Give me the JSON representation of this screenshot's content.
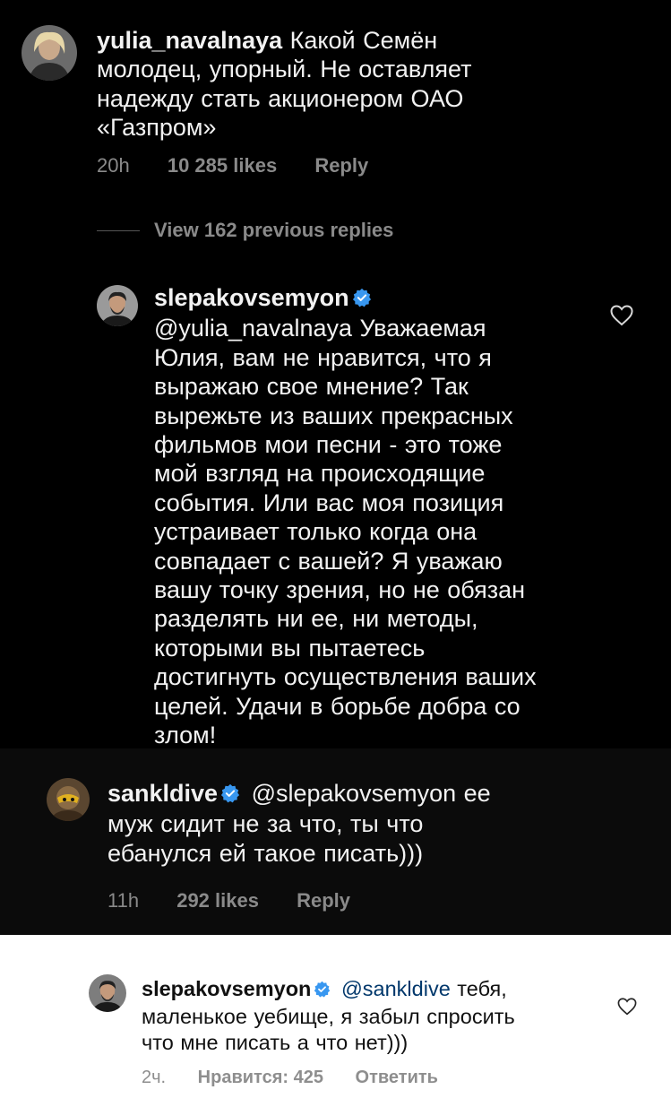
{
  "comment1": {
    "username": "yulia_navalnaya",
    "text_lines": [
      "Какой Семён",
      "молодец, упорный. Не оставляет",
      "надежду стать  акционером  ОАО",
      "«Газпром»"
    ],
    "time": "20h",
    "likes": "10 285 likes",
    "reply": "Reply"
  },
  "view_replies": "View 162 previous replies",
  "reply1": {
    "username": "slepakovsemyon",
    "verified": true,
    "text_lines": [
      "@yulia_navalnaya Уважаемая",
      "Юлия, вам не нравится, что я",
      "выражаю свое мнение? Так",
      "вырежьте из ваших прекрасных",
      "фильмов мои песни - это тоже",
      "мой взгляд на происходящие",
      "события. Или вас моя позиция",
      "устраивает только когда она",
      "совпадает с вашей? Я уважаю",
      "вашу точку зрения, но не обязан",
      "разделять ни ее, ни методы,",
      "которыми вы пытаетесь",
      "достигнуть осуществления ваших",
      "целей. Удачи в борьбе добра со",
      "злом!"
    ]
  },
  "comment2": {
    "username": "sankldive",
    "verified": true,
    "text_lines": [
      "@slepakovsemyon ее",
      "муж сидит не за что, ты что",
      "ебанулся ей такое писать)))"
    ],
    "time": "11h",
    "likes": "292 likes",
    "reply": "Reply"
  },
  "reply2": {
    "username": "slepakovsemyon",
    "verified": true,
    "mention": "@sankldive",
    "text_lines": [
      " тебя,",
      "маленькое уебище, я забыл спросить",
      "что мне писать а что нет)))"
    ],
    "time": "2ч.",
    "likes": "Нравится: 425",
    "reply": "Ответить"
  },
  "colors": {
    "verified_blue": "#3897f0",
    "mention_blue": "#00376b",
    "meta_gray": "#8a8a8a"
  },
  "icons": {
    "like": "heart-outline-icon",
    "verified": "verified-badge-icon"
  }
}
